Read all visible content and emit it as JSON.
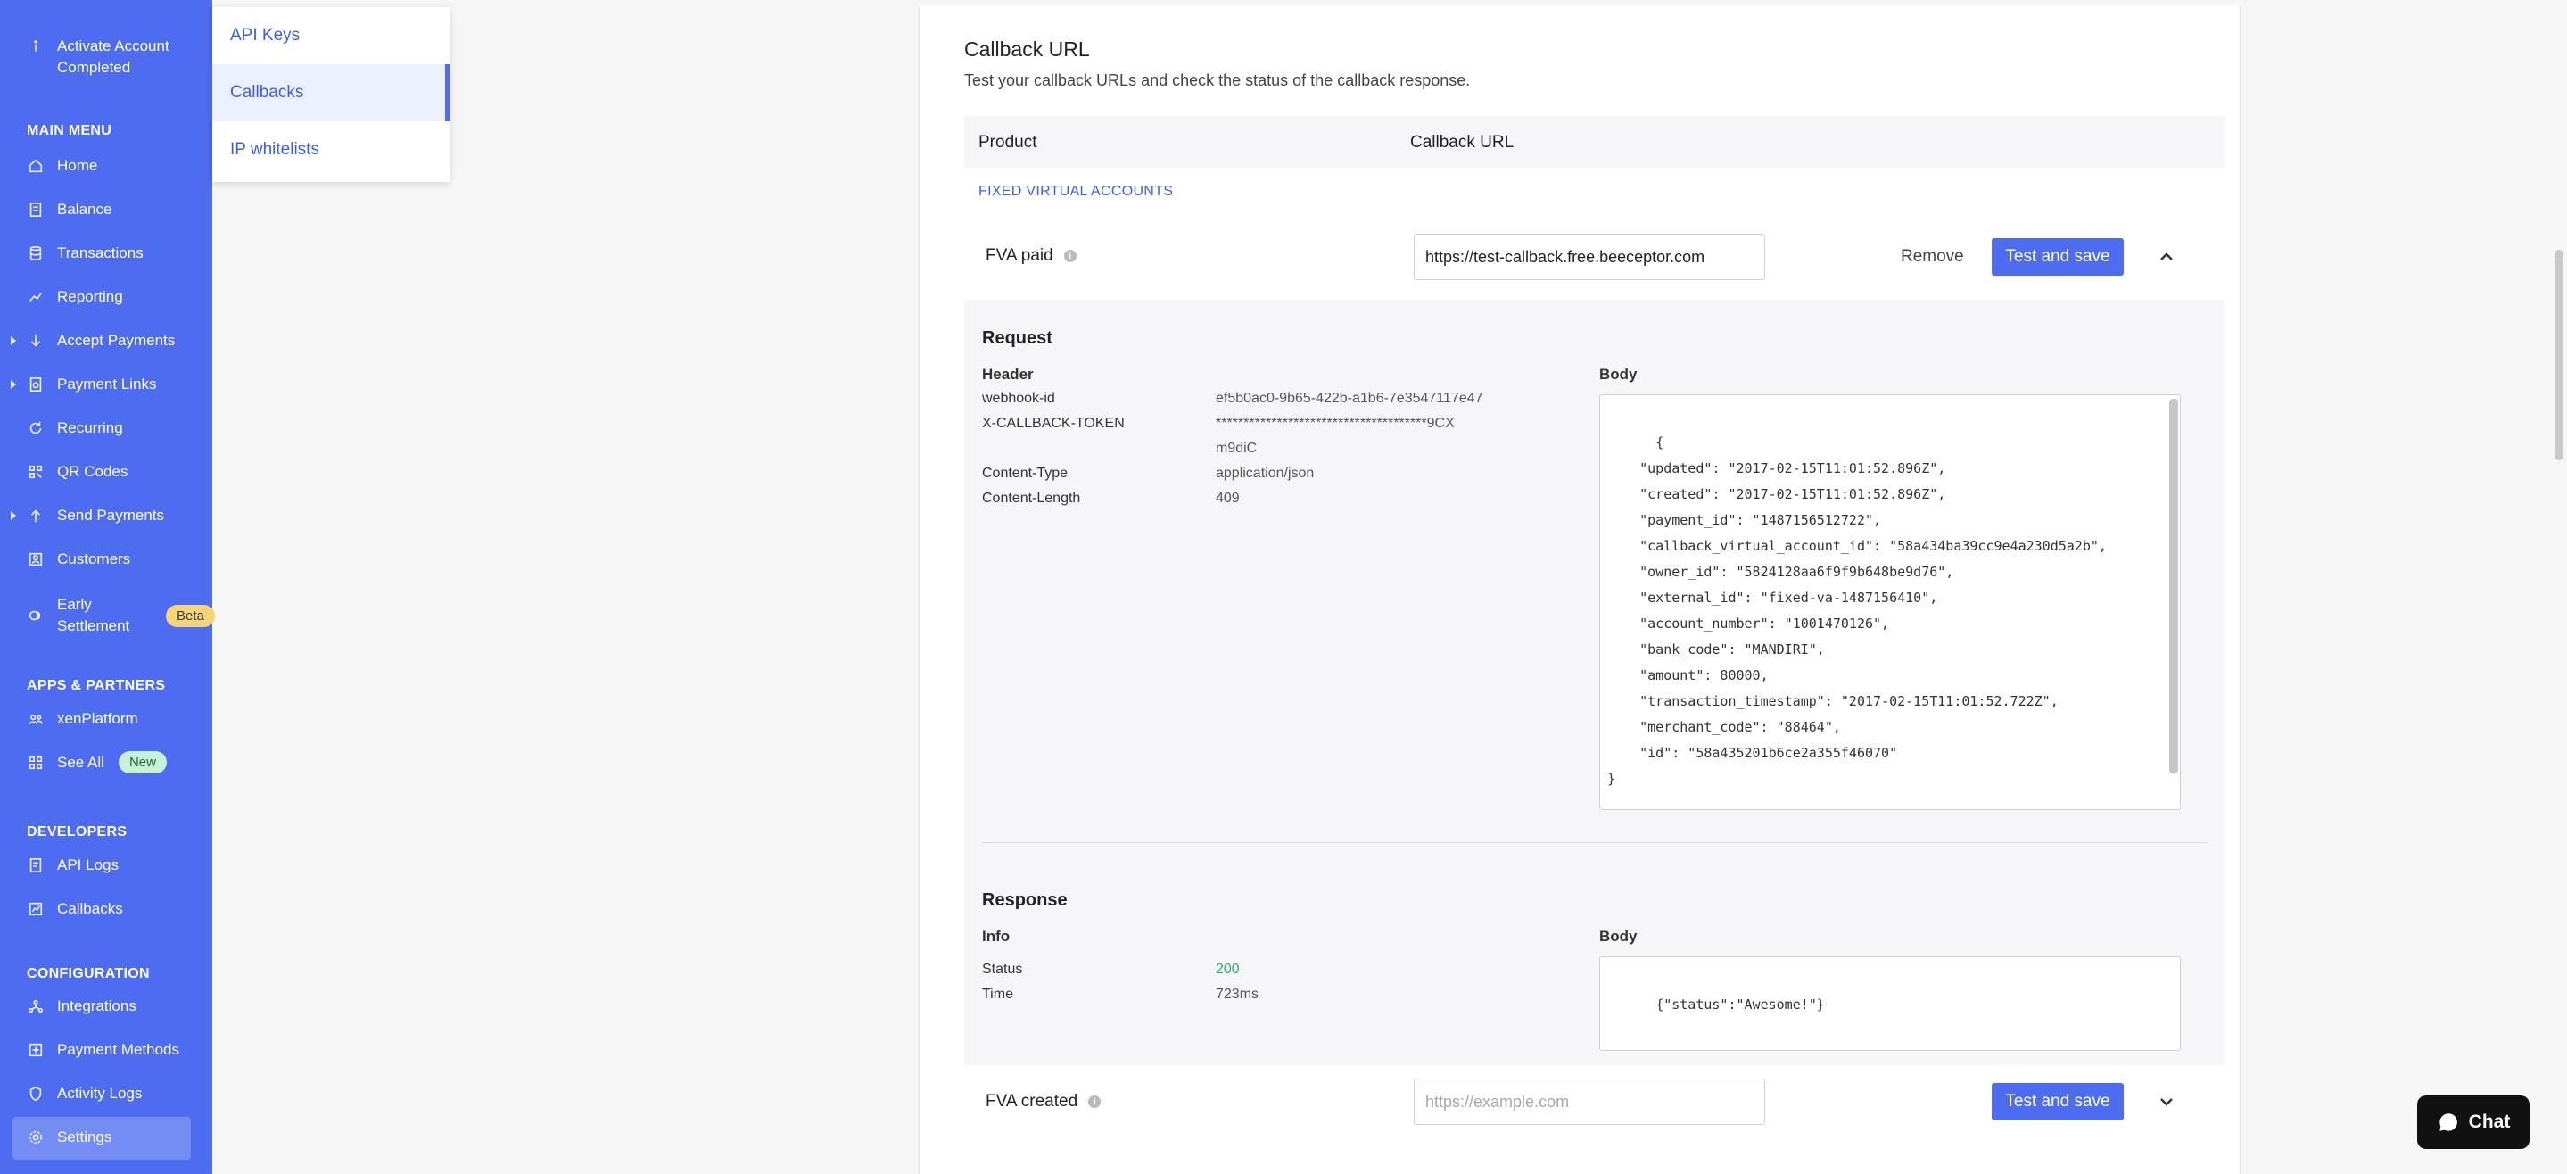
{
  "sidebar": {
    "activate": "Activate Account Completed",
    "main_menu_title": "MAIN MENU",
    "main_menu": [
      {
        "label": "Home"
      },
      {
        "label": "Balance"
      },
      {
        "label": "Transactions"
      },
      {
        "label": "Reporting"
      },
      {
        "label": "Accept Payments"
      },
      {
        "label": "Payment Links"
      },
      {
        "label": "Recurring"
      },
      {
        "label": "QR Codes"
      },
      {
        "label": "Send Payments"
      },
      {
        "label": "Customers"
      },
      {
        "label": "Early Settlement",
        "badge": "Beta"
      }
    ],
    "apps_title": "APPS & PARTNERS",
    "apps": [
      {
        "label": "xenPlatform"
      },
      {
        "label": "See All",
        "badge": "New"
      }
    ],
    "dev_title": "DEVELOPERS",
    "dev": [
      {
        "label": "API Logs"
      },
      {
        "label": "Callbacks"
      }
    ],
    "config_title": "CONFIGURATION",
    "config": [
      {
        "label": "Integrations"
      },
      {
        "label": "Payment Methods"
      },
      {
        "label": "Activity Logs"
      },
      {
        "label": "Settings"
      }
    ]
  },
  "submenu": {
    "items": [
      {
        "label": "API Keys"
      },
      {
        "label": "Callbacks"
      },
      {
        "label": "IP whitelists"
      }
    ],
    "active": "Callbacks"
  },
  "main": {
    "title": "Callback URL",
    "subtitle": "Test your callback URLs and check the status of the callback response.",
    "col_product": "Product",
    "col_callback": "Callback URL",
    "group": "FIXED VIRTUAL ACCOUNTS",
    "rows": [
      {
        "label": "FVA paid",
        "url": "https://test-callback.free.beeceptor.com",
        "placeholder": "https://example.com",
        "remove": "Remove",
        "test": "Test and save"
      },
      {
        "label": "FVA created",
        "url": "",
        "placeholder": "https://example.com",
        "test": "Test and save"
      }
    ],
    "request": {
      "title": "Request",
      "header_title": "Header",
      "body_title": "Body",
      "headers": [
        {
          "k": "webhook-id",
          "v": "ef5b0ac0-9b65-422b-a1b6-7e3547117e47"
        },
        {
          "k": "X-CALLBACK-TOKEN",
          "v": "**************************************9CX"
        },
        {
          "k": "",
          "v": "m9diC"
        },
        {
          "k": "Content-Type",
          "v": "application/json"
        },
        {
          "k": "Content-Length",
          "v": "409"
        }
      ],
      "body": "{\n    \"updated\": \"2017-02-15T11:01:52.896Z\",\n    \"created\": \"2017-02-15T11:01:52.896Z\",\n    \"payment_id\": \"1487156512722\",\n    \"callback_virtual_account_id\": \"58a434ba39cc9e4a230d5a2b\",\n    \"owner_id\": \"5824128aa6f9f9b648be9d76\",\n    \"external_id\": \"fixed-va-1487156410\",\n    \"account_number\": \"1001470126\",\n    \"bank_code\": \"MANDIRI\",\n    \"amount\": 80000,\n    \"transaction_timestamp\": \"2017-02-15T11:01:52.722Z\",\n    \"merchant_code\": \"88464\",\n    \"id\": \"58a435201b6ce2a355f46070\"\n}"
    },
    "response": {
      "title": "Response",
      "info_title": "Info",
      "body_title": "Body",
      "status_k": "Status",
      "status_v": "200",
      "time_k": "Time",
      "time_v": "723ms",
      "body": "{\"status\":\"Awesome!\"}"
    }
  },
  "chat": {
    "label": "Chat"
  },
  "colors": {
    "accent": "#4d6cf0",
    "success": "#2fae61",
    "beta": "#f6d57a",
    "new": "#c9f1d8"
  }
}
